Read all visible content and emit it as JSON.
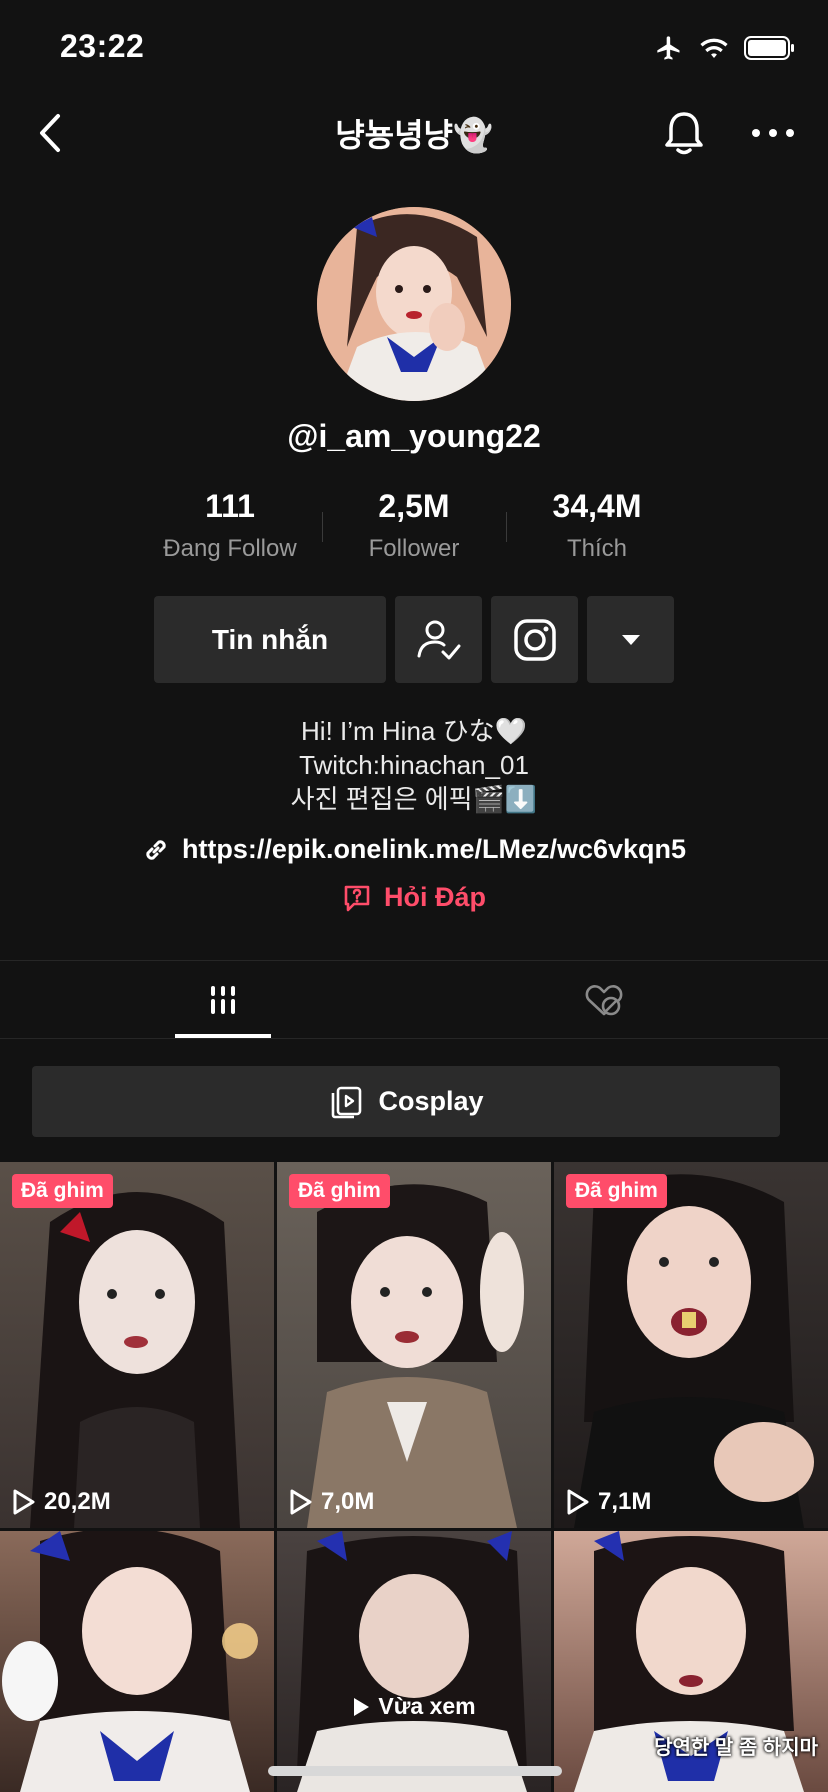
{
  "status_bar": {
    "time": "23:22",
    "icons": [
      "airplane-icon",
      "wifi-icon",
      "battery-icon"
    ]
  },
  "nav": {
    "title": "냥뇽녕냥👻",
    "icons": [
      "back-icon",
      "bell-icon",
      "more-icon"
    ]
  },
  "profile": {
    "username": "@i_am_young22",
    "stats": [
      {
        "value": "111",
        "label": "Đang Follow"
      },
      {
        "value": "2,5M",
        "label": "Follower"
      },
      {
        "value": "34,4M",
        "label": "Thích"
      }
    ],
    "message_button": "Tin nhắn",
    "bio_lines": [
      "Hi! I’m Hina ひな🤍",
      "Twitch:hinachan_01",
      "사진 편집은 에픽🎬⬇️"
    ],
    "link": "https://epik.onelink.me/LMez/wc6vkqn5",
    "qa_label": "Hỏi Đáp"
  },
  "tabs": {
    "items": [
      "videos-grid-tab",
      "liked-videos-tab"
    ]
  },
  "playlist": {
    "label": "Cosplay"
  },
  "videos": [
    {
      "pinned_label": "Đã ghim",
      "views": "20,2M"
    },
    {
      "pinned_label": "Đã ghim",
      "views": "7,0M"
    },
    {
      "pinned_label": "Đã ghim",
      "views": "7,1M"
    },
    {
      "views": ""
    },
    {
      "badge": "Vừa xem"
    },
    {
      "caption": "당연한 말 좀 하지마"
    }
  ],
  "colors": {
    "background": "#121212",
    "accent": "#ff4d6a",
    "button": "#2b2b2b"
  }
}
